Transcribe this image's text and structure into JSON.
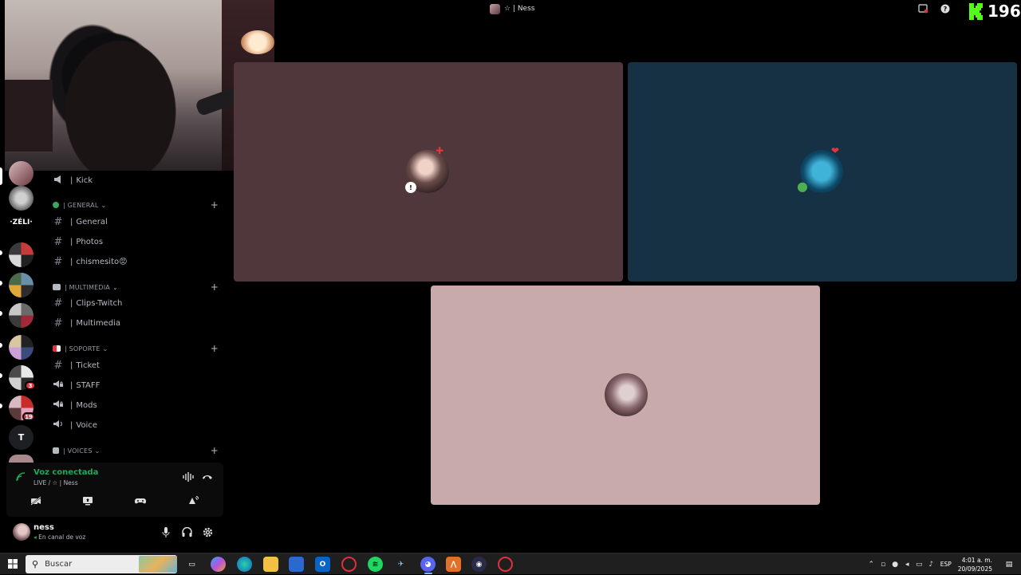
{
  "app": {
    "top_title": "☆ | Ness",
    "kick_count": "196"
  },
  "rail": {
    "text_server": "·ZÉLI·",
    "t_server": "T",
    "badges": [
      "3",
      "19"
    ]
  },
  "channels": {
    "items_top": [
      {
        "icon": "megaphone-icon",
        "label": "Kick"
      }
    ],
    "categories": [
      {
        "name": "| GENERAL",
        "icon_color": "#3ba55d",
        "channels": [
          {
            "icon": "hashtag-icon",
            "label": "General"
          },
          {
            "icon": "hashtag-icon",
            "label": "Photos"
          },
          {
            "icon": "hashtag-icon",
            "label": "chismesito😡"
          }
        ]
      },
      {
        "name": "| MULTIMEDIA",
        "icon_color": "#b5bac1",
        "channels": [
          {
            "icon": "hashtag-icon",
            "label": "Clips-Twitch"
          },
          {
            "icon": "hashtag-icon",
            "label": "Multimedia"
          }
        ]
      },
      {
        "name": "| SOPORTE",
        "icon_color": "#da373c",
        "channels": [
          {
            "icon": "hashtag-icon",
            "label": "Ticket"
          },
          {
            "icon": "speaker-locked-icon",
            "label": "STAFF"
          },
          {
            "icon": "speaker-locked-icon",
            "label": "Mods"
          },
          {
            "icon": "speaker-icon",
            "label": "Voice"
          }
        ]
      },
      {
        "name": "| VOICES",
        "icon_color": "#b5bac1",
        "channels": []
      }
    ]
  },
  "voice_panel": {
    "status": "Voz conectada",
    "channel": "LIVE / ☆ | Ness"
  },
  "user_panel": {
    "name": "ness",
    "status": "En canal de voz"
  },
  "taskbar": {
    "search_placeholder": "Buscar",
    "language": "ESP",
    "time": "4:01 a. m.",
    "date": "20/09/2025"
  },
  "colors": {
    "tile_a": "#4f373c",
    "tile_b": "#163044",
    "tile_c": "#c8aaab",
    "voice_green": "#23a55a",
    "kick_green": "#53fc18"
  }
}
